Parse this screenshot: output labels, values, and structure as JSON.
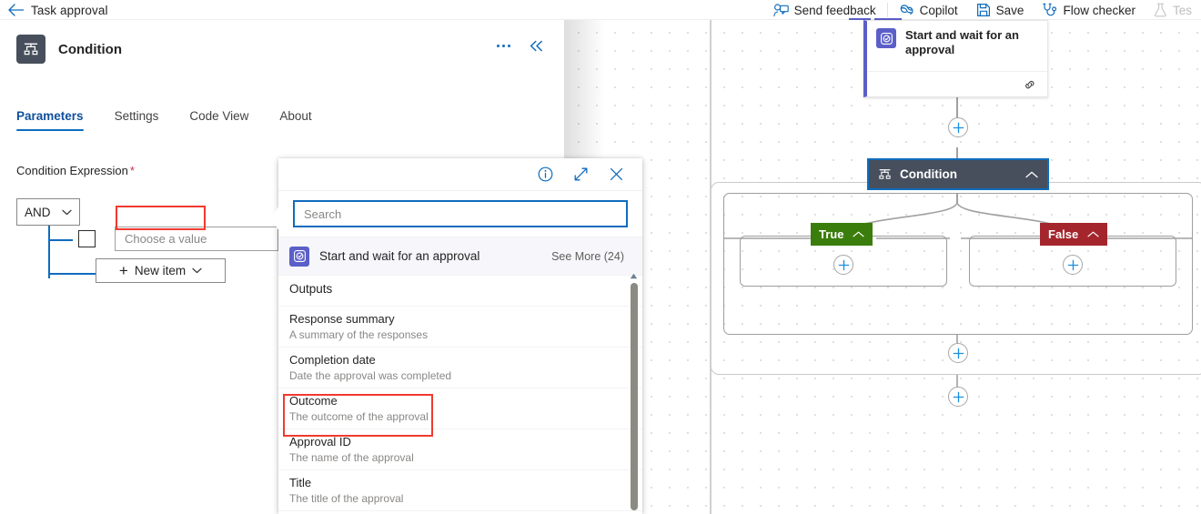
{
  "topbar": {
    "back_label": "back-arrow",
    "flow_title": "Task approval",
    "items": [
      {
        "label": "Send feedback",
        "icon": "person-feedback-icon",
        "disabled": false
      },
      {
        "label": "Copilot",
        "icon": "copilot-icon",
        "disabled": false
      },
      {
        "label": "Save",
        "icon": "save-disk-icon",
        "disabled": false
      },
      {
        "label": "Flow checker",
        "icon": "stethoscope-icon",
        "disabled": false
      },
      {
        "label": "Tes",
        "icon": "flask-icon",
        "disabled": true
      }
    ]
  },
  "panel": {
    "icon": "condition-branch-icon",
    "title": "Condition",
    "more_actions_icon": "ellipsis-icon",
    "collapse_icon": "double-chevron-left-icon",
    "tabs": [
      {
        "label": "Parameters",
        "active": true
      },
      {
        "label": "Settings",
        "active": false
      },
      {
        "label": "Code View",
        "active": false
      },
      {
        "label": "About",
        "active": false
      }
    ],
    "field_label": "Condition Expression",
    "required_marker": "*",
    "builder": {
      "operator": "AND",
      "operator_chevron": "chevron-down-icon",
      "value_placeholder": "Choose a value",
      "new_item_label": "New item",
      "new_item_plus": "+",
      "new_item_chevron": "chevron-down-icon"
    }
  },
  "flyout": {
    "info_icon": "info-circle-icon",
    "expand_icon": "expand-diagonal-icon",
    "close_icon": "close-x-icon",
    "search_placeholder": "Search",
    "group": {
      "icon": "approval-icon",
      "name": "Start and wait for an approval",
      "see_more_label": "See More",
      "see_more_count": "(24)"
    },
    "section_title": "Outputs",
    "items": [
      {
        "title": "Response summary",
        "desc": "A summary of the responses",
        "highlighted": false
      },
      {
        "title": "Completion date",
        "desc": "Date the approval was completed",
        "highlighted": false
      },
      {
        "title": "Outcome",
        "desc": "The outcome of the approval",
        "highlighted": true
      },
      {
        "title": "Approval ID",
        "desc": "The name of the approval",
        "highlighted": false
      },
      {
        "title": "Title",
        "desc": "The title of the approval",
        "highlighted": false
      }
    ],
    "scroll_up_icon": "scroll-up-arrow-icon"
  },
  "canvas": {
    "approval_node": {
      "title": "Start and wait for an approval",
      "icon": "approval-icon",
      "footer_icon": "link-chain-icon",
      "accent_color": "#5b5fc7"
    },
    "condition_node": {
      "label": "Condition",
      "icon": "condition-branch-icon",
      "collapse_chevron": "chevron-up-icon",
      "background_color": "#474f5d",
      "selection_color": "#0f6cbd"
    },
    "branches": [
      {
        "label": "True",
        "color": "#3b7d0c",
        "chevron": "chevron-up-icon",
        "add_icon": "plus-icon"
      },
      {
        "label": "False",
        "color": "#a4262c",
        "chevron": "chevron-up-icon",
        "add_icon": "plus-icon"
      }
    ],
    "add_buttons": [
      "plus-icon",
      "plus-icon",
      "plus-icon"
    ]
  },
  "colors": {
    "accent_blue": "#0f6cbd",
    "highlight_red": "#f03a2f",
    "purple": "#5b5fc7",
    "dark_node": "#474f5d"
  }
}
